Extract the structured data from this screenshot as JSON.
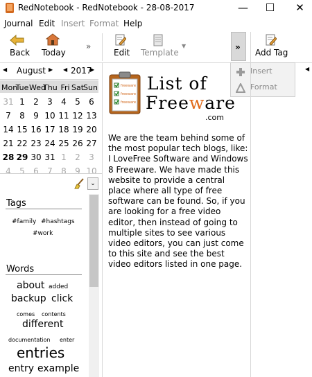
{
  "window": {
    "title": "RedNotebook - RedNotebook - 28-08-2017",
    "minimize": "—",
    "maximize": "☐",
    "close": "✕"
  },
  "menu": [
    {
      "label": "Journal",
      "enabled": true
    },
    {
      "label": "Edit",
      "enabled": true
    },
    {
      "label": "Insert",
      "enabled": false
    },
    {
      "label": "Format",
      "enabled": false
    },
    {
      "label": "Help",
      "enabled": true
    }
  ],
  "toolbar": {
    "back": "Back",
    "today": "Today",
    "more": "»",
    "edit": "Edit",
    "template": "Template",
    "template_arrow": "▼",
    "overflow": "»",
    "add_tag": "Add Tag"
  },
  "overflow_menu": {
    "insert": "Insert",
    "format": "Format"
  },
  "calendar": {
    "month": "August",
    "year": "2017",
    "weekdays": [
      "Mon",
      "Tue",
      "Wed",
      "Thu",
      "Fri",
      "Sat",
      "Sun"
    ],
    "weeks": [
      [
        "31",
        "1",
        "2",
        "3",
        "4",
        "5",
        "6"
      ],
      [
        "7",
        "8",
        "9",
        "10",
        "11",
        "12",
        "13"
      ],
      [
        "14",
        "15",
        "16",
        "17",
        "18",
        "19",
        "20"
      ],
      [
        "21",
        "22",
        "23",
        "24",
        "25",
        "26",
        "27"
      ],
      [
        "28",
        "29",
        "30",
        "31",
        "1",
        "2",
        "3"
      ],
      [
        "4",
        "5",
        "6",
        "7",
        "8",
        "9",
        "10"
      ]
    ],
    "selected_day": "28"
  },
  "tags": {
    "heading": "Tags",
    "items": [
      "#family",
      "#hashtags",
      "#work"
    ]
  },
  "words": {
    "heading": "Words",
    "cloud": [
      "about",
      "added",
      "backup",
      "click",
      "comes",
      "contents",
      "different",
      "documentation",
      "enter",
      "entries",
      "entry",
      "example"
    ]
  },
  "editor": {
    "logo_line1": "List of",
    "logo_line2_a": "Free",
    "logo_line2_b": "w",
    "logo_line2_c": "are",
    "logo_line3": ".com",
    "logo_board_lines": [
      "freeware",
      "freeware",
      "freeware"
    ],
    "body": "We are the team behind some of the most popular tech blogs, like: I LoveFree Software and Windows 8 Freeware. We have made this website to provide a central place where all type of free software can be found. So, if you are looking for a free video editor, then instead of going to multiple sites to see various video editors, you can just come to this site and see the best video editors listed in one page."
  },
  "colors": {
    "selection_gray": "#d9d9d9",
    "logo_orange": "#e06a1b",
    "clipboard_brown": "#b5651d"
  }
}
